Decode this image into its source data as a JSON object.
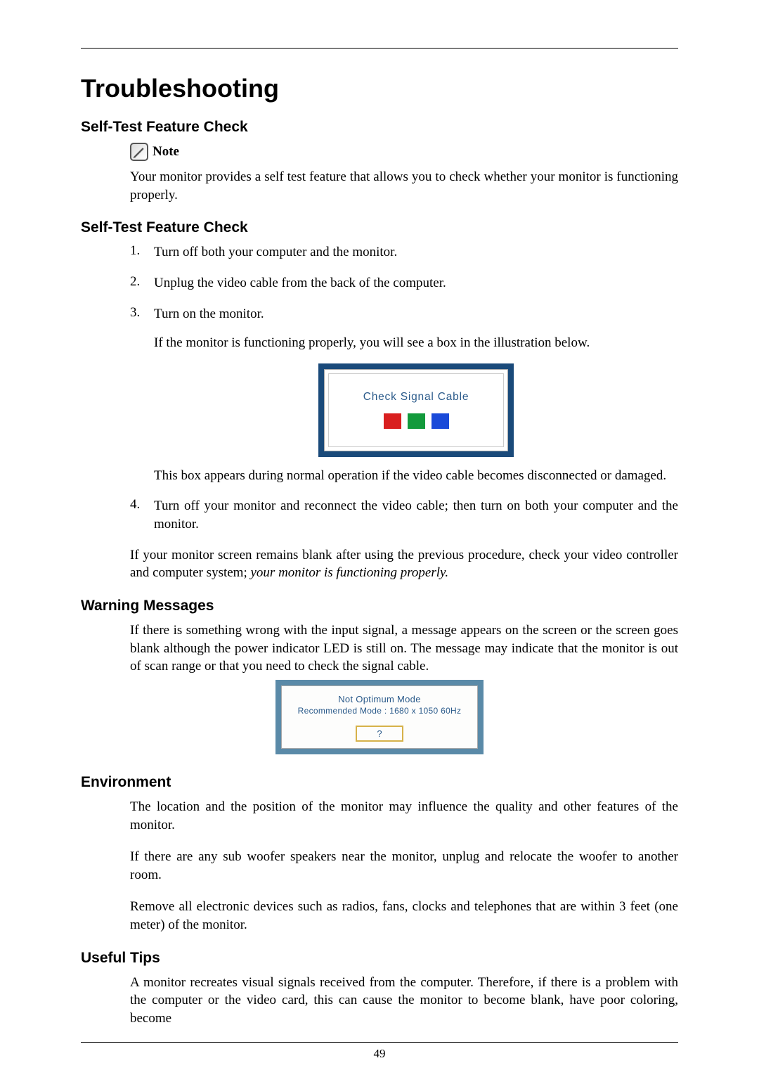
{
  "page": {
    "title": "Troubleshooting",
    "number": "49"
  },
  "sections": {
    "selfTest1": {
      "heading": "Self-Test Feature Check",
      "noteLabel": "Note",
      "body": "Your monitor provides a self test feature that allows you to check whether your monitor is functioning properly."
    },
    "selfTest2": {
      "heading": "Self-Test Feature Check",
      "items": {
        "1": "Turn off both your computer and the monitor.",
        "2": "Unplug the video cable from the back of the computer.",
        "3a": "Turn on the monitor.",
        "3b": "If the monitor is functioning properly, you will see a box in the illustration below.",
        "3c": "This box appears during normal operation if the video cable becomes disconnected or damaged.",
        "4": "Turn off your monitor and reconnect the video cable; then turn on both your computer and the monitor."
      },
      "closing_plain": "If your monitor screen remains blank after using the previous procedure, check your video controller and computer system; ",
      "closing_italic": "your monitor is functioning properly."
    },
    "warning": {
      "heading": "Warning Messages",
      "body": "If there is something wrong with the input signal, a message appears on the screen or the screen goes blank although the power indicator LED is still on. The message may indicate that the monitor is out of scan range or that you need to check the signal cable."
    },
    "environment": {
      "heading": "Environment",
      "p1": "The location and the position of the monitor may influence the quality and other features of the monitor.",
      "p2": "If there are any sub woofer speakers near the monitor, unplug and relocate the woofer to another room.",
      "p3": "Remove all electronic devices such as radios, fans, clocks and telephones that are within 3 feet (one meter) of the monitor."
    },
    "tips": {
      "heading": "Useful Tips",
      "p1": "A monitor recreates visual signals received from the computer. Therefore, if there is a problem with the computer or the video card, this can cause the monitor to become blank, have poor coloring, become"
    }
  },
  "figures": {
    "checkSignal": {
      "text": "Check Signal Cable"
    },
    "optimum": {
      "line1": "Not Optimum Mode",
      "line2": "Recommended Mode : 1680 x 1050 60Hz",
      "button": "?"
    }
  }
}
